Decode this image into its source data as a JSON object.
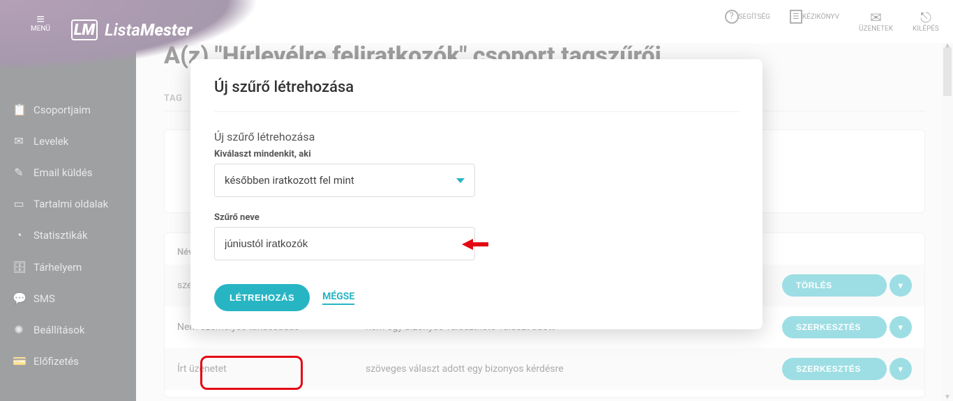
{
  "brand": {
    "mark": "LM",
    "name_light": "Lista",
    "name_bold": "Mester"
  },
  "menu_button": {
    "label": "MENÜ"
  },
  "header_actions": [
    {
      "icon": "help-icon",
      "glyph": "?",
      "label": "SEGÍTSÉG"
    },
    {
      "icon": "manual-icon",
      "glyph": "☰",
      "label": "KÉZIKÖNYV"
    },
    {
      "icon": "messages-icon",
      "glyph": "✉",
      "label": "ÜZENETEK"
    },
    {
      "icon": "logout-icon",
      "glyph": "⎋",
      "label": "KILÉPÉS"
    }
  ],
  "sidebar": {
    "items": [
      {
        "icon": "groups-icon",
        "glyph": "📋",
        "label": "Csoportjaim"
      },
      {
        "icon": "mails-icon",
        "glyph": "✉",
        "label": "Levelek"
      },
      {
        "icon": "send-icon",
        "glyph": "✎",
        "label": "Email küldés"
      },
      {
        "icon": "pages-icon",
        "glyph": "▭",
        "label": "Tartalmi oldalak"
      },
      {
        "icon": "stats-icon",
        "glyph": "◔",
        "label": "Statisztikák"
      },
      {
        "icon": "storage-icon",
        "glyph": "🗄",
        "label": "Tárhelyem"
      },
      {
        "icon": "sms-icon",
        "glyph": "💬",
        "label": "SMS"
      },
      {
        "icon": "settings-icon",
        "glyph": "✺",
        "label": "Beállítások"
      },
      {
        "icon": "subscription-icon",
        "glyph": "💳",
        "label": "Előfizetés"
      }
    ]
  },
  "page": {
    "title": "A(z) \"Hírlevélre feliratkozók\" csoport tagszűrői",
    "tab_label": "TAG"
  },
  "table": {
    "header": "Név",
    "rows": [
      {
        "c1": "sze",
        "c2": "",
        "action": "TÖRLÉS"
      },
      {
        "c1": "Nem személyes tanácsadás",
        "c2": "nem egy bizonyos választható választ adott",
        "action": "SZERKESZTÉS"
      },
      {
        "c1": "Írt üzenetet",
        "c2": "szöveges választ adott egy bizonyos kérdésre",
        "action": "SZERKESZTÉS"
      }
    ],
    "caret": "▾"
  },
  "modal": {
    "title": "Új szűrő létrehozása",
    "subtitle": "Új szűrő létrehozása",
    "select_label": "Kiválaszt mindenkit, aki",
    "select_value": "későbben iratkozott fel mint",
    "name_label": "Szűrő neve",
    "name_value": "júniustól iratkozók",
    "create_btn": "LÉTREHOZÁS",
    "cancel_btn": "MÉGSE"
  }
}
